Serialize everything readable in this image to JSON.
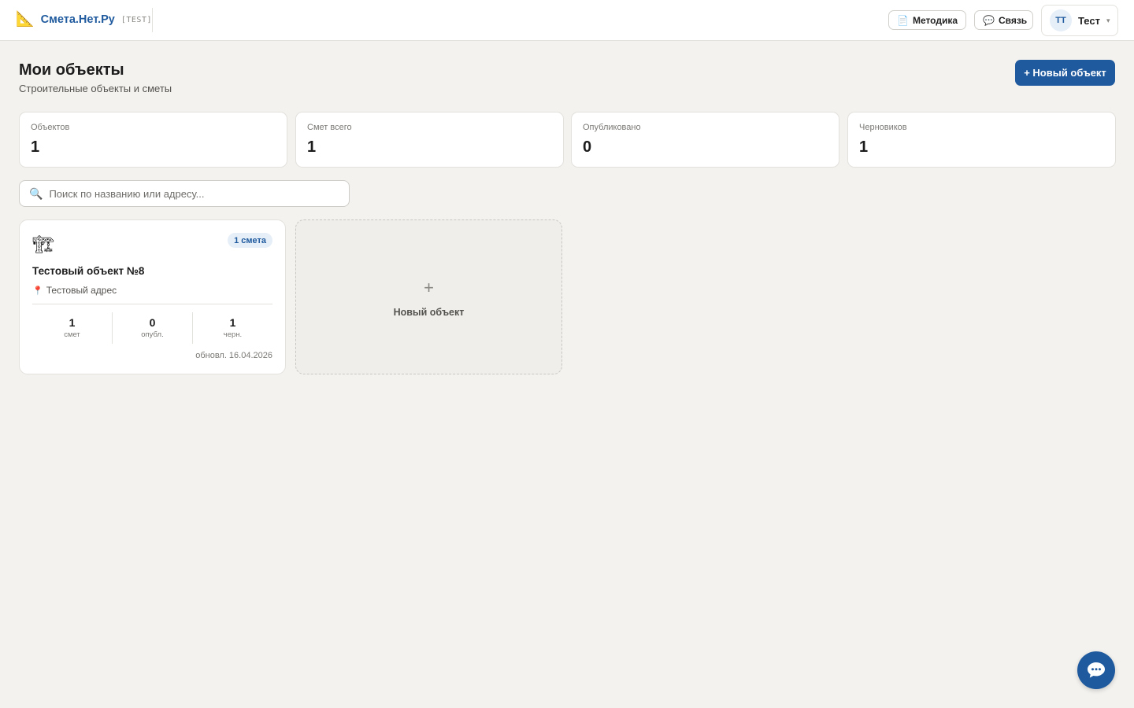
{
  "header": {
    "logo_icon": "📐",
    "logo_text": "Смета.Нет.Ру",
    "env_tag": "[TEST]",
    "method_icon": "📄",
    "method_label": "Методика",
    "contact_icon": "💬",
    "contact_label": "Связь",
    "user_initials": "ТТ",
    "user_name": "Тест",
    "user_caret": "▾"
  },
  "page": {
    "title": "Мои объекты",
    "subtitle": "Строительные объекты и сметы",
    "new_button": "+ Новый объект"
  },
  "stats": [
    {
      "label": "Объектов",
      "value": "1"
    },
    {
      "label": "Смет всего",
      "value": "1"
    },
    {
      "label": "Опубликовано",
      "value": "0"
    },
    {
      "label": "Черновиков",
      "value": "1"
    }
  ],
  "search": {
    "icon": "🔍",
    "placeholder": "Поиск по названию или адресу...",
    "value": ""
  },
  "objects": [
    {
      "icon": "🏗",
      "badge": "1 смета",
      "title": "Тестовый объект №8",
      "address_icon": "📍",
      "address": "Тестовый адрес",
      "counts": [
        {
          "value": "1",
          "label": "смет"
        },
        {
          "value": "0",
          "label": "опубл."
        },
        {
          "value": "1",
          "label": "черн."
        }
      ],
      "updated": "обновл. 16.04.2026"
    }
  ],
  "new_card": {
    "plus": "+",
    "label": "Новый объект"
  },
  "colors": {
    "accent": "#1f5a9e",
    "background": "#f3f2ef",
    "badge_bg": "#e6eef8"
  },
  "chat_fab_icon": "chat-bubble-icon"
}
